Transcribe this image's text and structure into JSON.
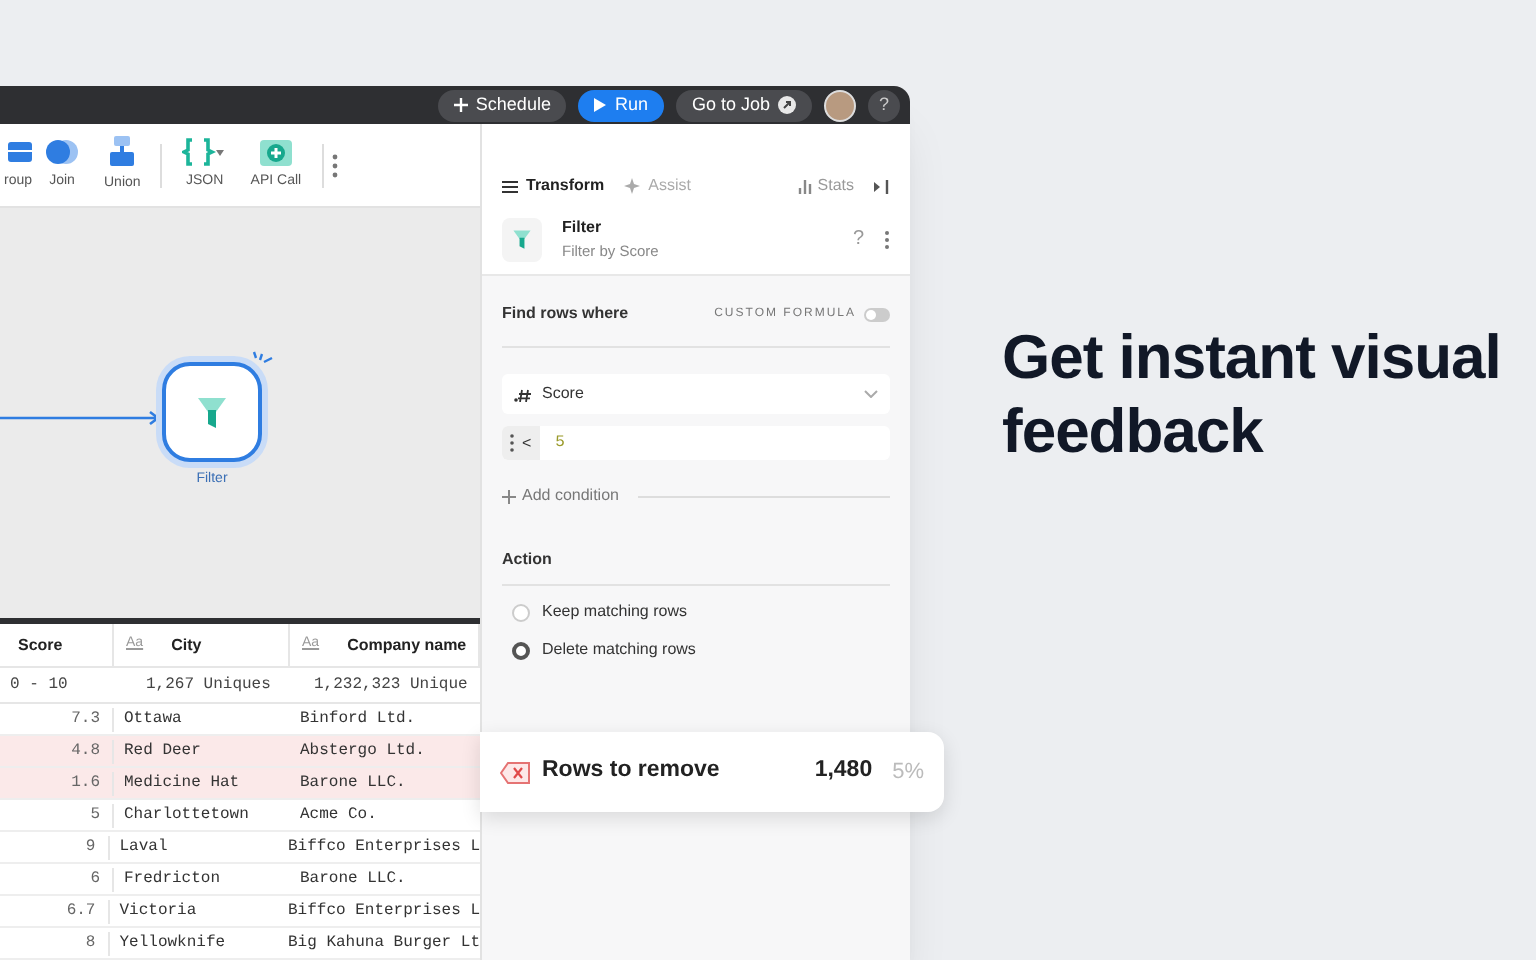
{
  "top_bar": {
    "buttons": [
      {
        "kind": "schedule",
        "label": "Schedule"
      },
      {
        "kind": "run",
        "label": "Run"
      },
      {
        "kind": "goto",
        "label": "Go to Job"
      }
    ],
    "help": "?"
  },
  "toolbar": {
    "items": [
      {
        "kind": "group",
        "label": "roup"
      },
      {
        "kind": "join",
        "label": "Join"
      },
      {
        "kind": "union",
        "label": "Union"
      },
      {
        "kind": "json",
        "label": "JSON"
      },
      {
        "kind": "api",
        "label": "API Call"
      }
    ]
  },
  "canvas": {
    "node": {
      "label": "Filter",
      "selected": true
    }
  },
  "table": {
    "columns": [
      {
        "name": "Score",
        "stats": "0 - 10"
      },
      {
        "name": "City",
        "type_icon": "Aa",
        "stats": "1,267 Uniques"
      },
      {
        "name": "Company name",
        "type_icon": "Aa",
        "stats": "1,232,323 Unique"
      }
    ],
    "rows": [
      {
        "cells": [
          "7.3",
          "Ottawa",
          "Binford Ltd."
        ],
        "highlighted": false
      },
      {
        "cells": [
          "4.8",
          "Red Deer",
          "Abstergo Ltd."
        ],
        "highlighted": true
      },
      {
        "cells": [
          "1.6",
          "Medicine Hat",
          "Barone LLC."
        ],
        "highlighted": true
      },
      {
        "cells": [
          "5",
          "Charlottetown",
          "Acme Co."
        ],
        "highlighted": false
      },
      {
        "cells": [
          "9",
          "Laval",
          "Biffco Enterprises L"
        ],
        "highlighted": false
      },
      {
        "cells": [
          "6",
          "Fredricton",
          "Barone LLC."
        ],
        "highlighted": false
      },
      {
        "cells": [
          "6.7",
          "Victoria",
          "Biffco Enterprises L"
        ],
        "highlighted": false
      },
      {
        "cells": [
          "8",
          "Yellowknife",
          "Big Kahuna Burger Lt"
        ],
        "highlighted": false
      }
    ]
  },
  "panel": {
    "tabs": [
      {
        "label": "Transform",
        "selected": true
      },
      {
        "label": "Assist",
        "selected": false
      }
    ],
    "stats": "Stats",
    "step": {
      "title": "Filter",
      "subtitle": "Filter by Score",
      "help": "?"
    },
    "find_label": "Find rows where",
    "custom_formula": {
      "label": "CUSTOM FORMULA",
      "on": false
    },
    "field": "Score",
    "operator": "<",
    "value": "5",
    "add_condition": "Add condition",
    "action_label": "Action",
    "options": [
      {
        "label": "Keep matching rows",
        "selected": false
      },
      {
        "label": "Delete matching rows",
        "selected": true
      }
    ]
  },
  "summary": {
    "label": "Rows to remove",
    "count": "1,480",
    "percent": "5%"
  },
  "headline": "Get instant visual feedback"
}
